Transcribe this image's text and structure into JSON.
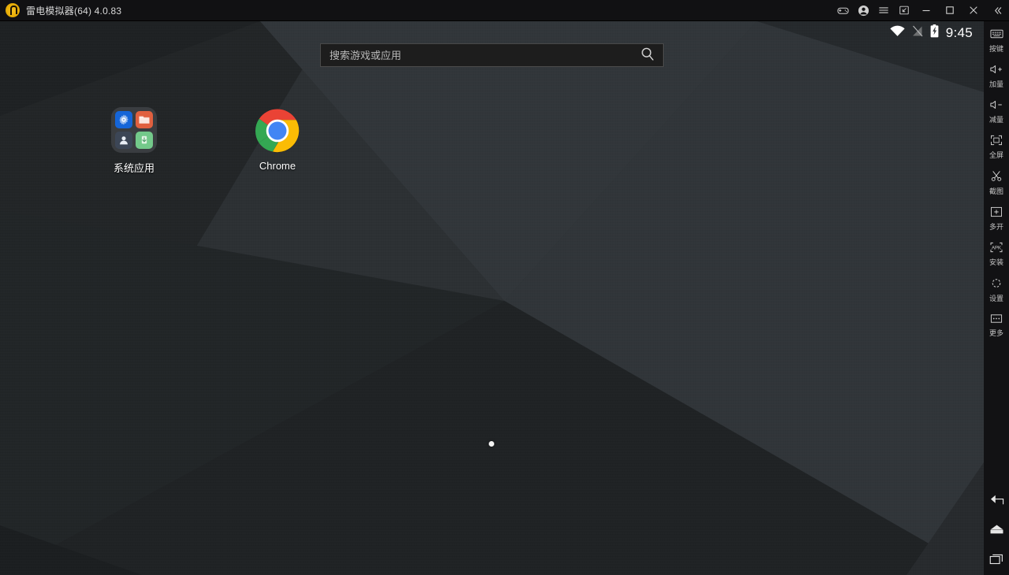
{
  "window": {
    "title": "雷电模拟器(64) 4.0.83",
    "logo_icon": "ldplayer-logo-icon",
    "controls": [
      {
        "name": "gamepad-icon",
        "label": "手柄"
      },
      {
        "name": "account-icon",
        "label": "账号"
      },
      {
        "name": "menu-icon",
        "label": "菜单"
      },
      {
        "name": "screenshot-icon",
        "label": "截图"
      },
      {
        "name": "minimize-icon",
        "label": "最小化"
      },
      {
        "name": "maximize-icon",
        "label": "最大化"
      },
      {
        "name": "close-icon",
        "label": "关闭"
      },
      {
        "name": "collapse-icon",
        "label": "收起"
      }
    ]
  },
  "statusbar": {
    "wifi_icon": "wifi-icon",
    "signal_icon": "no-sim-icon",
    "battery_icon": "battery-charging-icon",
    "time": "9:45"
  },
  "search": {
    "placeholder": "搜索游戏或应用",
    "value": "",
    "icon": "search-icon"
  },
  "desktop": {
    "icons": [
      {
        "name": "folder-system-apps",
        "label": "系统应用",
        "type": "folder",
        "mini_icons": [
          "settings-icon",
          "file-manager-icon",
          "contacts-icon",
          "downloads-icon"
        ]
      },
      {
        "name": "app-chrome",
        "label": "Chrome",
        "type": "app",
        "icon": "chrome-icon"
      }
    ],
    "page_indicator": {
      "pages": 1,
      "current": 1
    }
  },
  "toolbar": {
    "items": [
      {
        "icon": "keyboard-icon",
        "label": "按键"
      },
      {
        "icon": "volume-up-icon",
        "label": "加量"
      },
      {
        "icon": "volume-down-icon",
        "label": "减量"
      },
      {
        "icon": "fullscreen-icon",
        "label": "全屏"
      },
      {
        "icon": "scissors-icon",
        "label": "截图"
      },
      {
        "icon": "multi-instance-icon",
        "label": "多开"
      },
      {
        "icon": "apk-install-icon",
        "label": "安装"
      },
      {
        "icon": "settings-gear-icon",
        "label": "设置"
      },
      {
        "icon": "more-icon",
        "label": "更多"
      }
    ],
    "nav": [
      {
        "icon": "back-icon",
        "label": "返回"
      },
      {
        "icon": "home-icon",
        "label": "主页"
      },
      {
        "icon": "recents-icon",
        "label": "最近任务"
      }
    ]
  },
  "colors": {
    "titlebar_bg": "#111113",
    "toolbar_bg": "#121214",
    "accent_logo": "#e8ae08",
    "text_primary": "#ffffff",
    "text_secondary": "#c4c4c4",
    "chrome_red": "#e8453c",
    "chrome_green": "#2aa94f",
    "chrome_yellow": "#f5bc00",
    "chrome_blue": "#4285f4"
  }
}
